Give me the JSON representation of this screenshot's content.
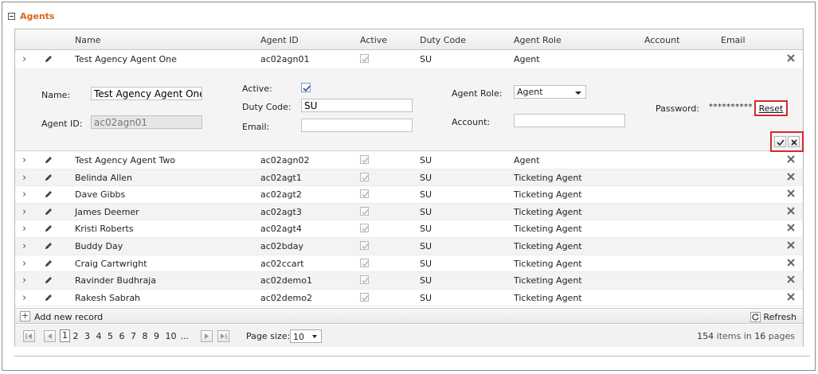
{
  "panel": {
    "title": "Agents"
  },
  "columns": {
    "name": "Name",
    "agent_id": "Agent ID",
    "active": "Active",
    "duty_code": "Duty Code",
    "agent_role": "Agent Role",
    "account": "Account",
    "email": "Email"
  },
  "expanded_row": {
    "name": "Test Agency Agent One",
    "agent_id": "ac02agn01",
    "duty_code": "SU",
    "agent_role": "Agent"
  },
  "edit_form": {
    "name_label": "Name:",
    "name_value": "Test Agency Agent One",
    "agent_id_label": "Agent ID:",
    "agent_id_value": "ac02agn01",
    "active_label": "Active:",
    "duty_code_label": "Duty Code:",
    "duty_code_value": "SU",
    "email_label": "Email:",
    "email_value": "",
    "agent_role_label": "Agent Role:",
    "agent_role_value": "Agent",
    "account_label": "Account:",
    "account_value": "",
    "password_label": "Password:",
    "password_value": "**********",
    "reset_label": "Reset"
  },
  "rows": [
    {
      "name": "Test Agency Agent Two",
      "agent_id": "ac02agn02",
      "duty_code": "SU",
      "agent_role": "Agent"
    },
    {
      "name": "Belinda Allen",
      "agent_id": "ac02agt1",
      "duty_code": "SU",
      "agent_role": "Ticketing Agent"
    },
    {
      "name": "Dave Gibbs",
      "agent_id": "ac02agt2",
      "duty_code": "SU",
      "agent_role": "Ticketing Agent"
    },
    {
      "name": "James Deemer",
      "agent_id": "ac02agt3",
      "duty_code": "SU",
      "agent_role": "Ticketing Agent"
    },
    {
      "name": "Kristi Roberts",
      "agent_id": "ac02agt4",
      "duty_code": "SU",
      "agent_role": "Ticketing Agent"
    },
    {
      "name": "Buddy Day",
      "agent_id": "ac02bday",
      "duty_code": "SU",
      "agent_role": "Ticketing Agent"
    },
    {
      "name": "Craig Cartwright",
      "agent_id": "ac02ccart",
      "duty_code": "SU",
      "agent_role": "Ticketing Agent"
    },
    {
      "name": "Ravinder Budhraja",
      "agent_id": "ac02demo1",
      "duty_code": "SU",
      "agent_role": "Ticketing Agent"
    },
    {
      "name": "Rakesh Sabrah",
      "agent_id": "ac02demo2",
      "duty_code": "SU",
      "agent_role": "Ticketing Agent"
    }
  ],
  "toolbar": {
    "add_label": "Add new record",
    "refresh_label": "Refresh"
  },
  "pager": {
    "pages": [
      "1",
      "2",
      "3",
      "4",
      "5",
      "6",
      "7",
      "8",
      "9",
      "10",
      "..."
    ],
    "current_page": "1",
    "page_size_label": "Page size:",
    "page_size_value": "10",
    "total_items": "154",
    "items_in": "items in",
    "total_pages": "16",
    "pages_word": "pages"
  }
}
